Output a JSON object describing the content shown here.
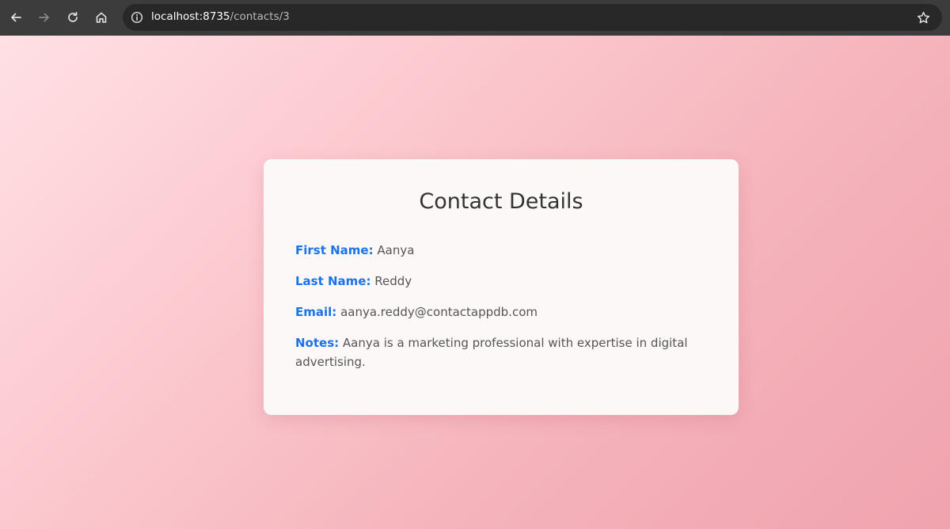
{
  "browser": {
    "url_host": "localhost:8735",
    "url_path": "/contacts/3",
    "icons": {
      "back": "arrow-left-icon",
      "forward": "arrow-right-icon",
      "reload": "reload-icon",
      "home": "home-icon",
      "site_info": "info-icon",
      "bookmark": "star-icon"
    }
  },
  "page": {
    "title": "Contact Details",
    "fields": [
      {
        "label": "First Name:",
        "value": "Aanya"
      },
      {
        "label": "Last Name:",
        "value": "Reddy"
      },
      {
        "label": "Email:",
        "value": "aanya.reddy@contactappdb.com"
      },
      {
        "label": "Notes:",
        "value": "Aanya is a marketing professional with expertise in digital advertising."
      }
    ]
  },
  "colors": {
    "label": "#1a73e8",
    "text": "#555555",
    "title": "#333333",
    "card_bg": "#fdf8f8",
    "toolbar_bg": "#3c3c3c",
    "address_bg": "#282828"
  }
}
